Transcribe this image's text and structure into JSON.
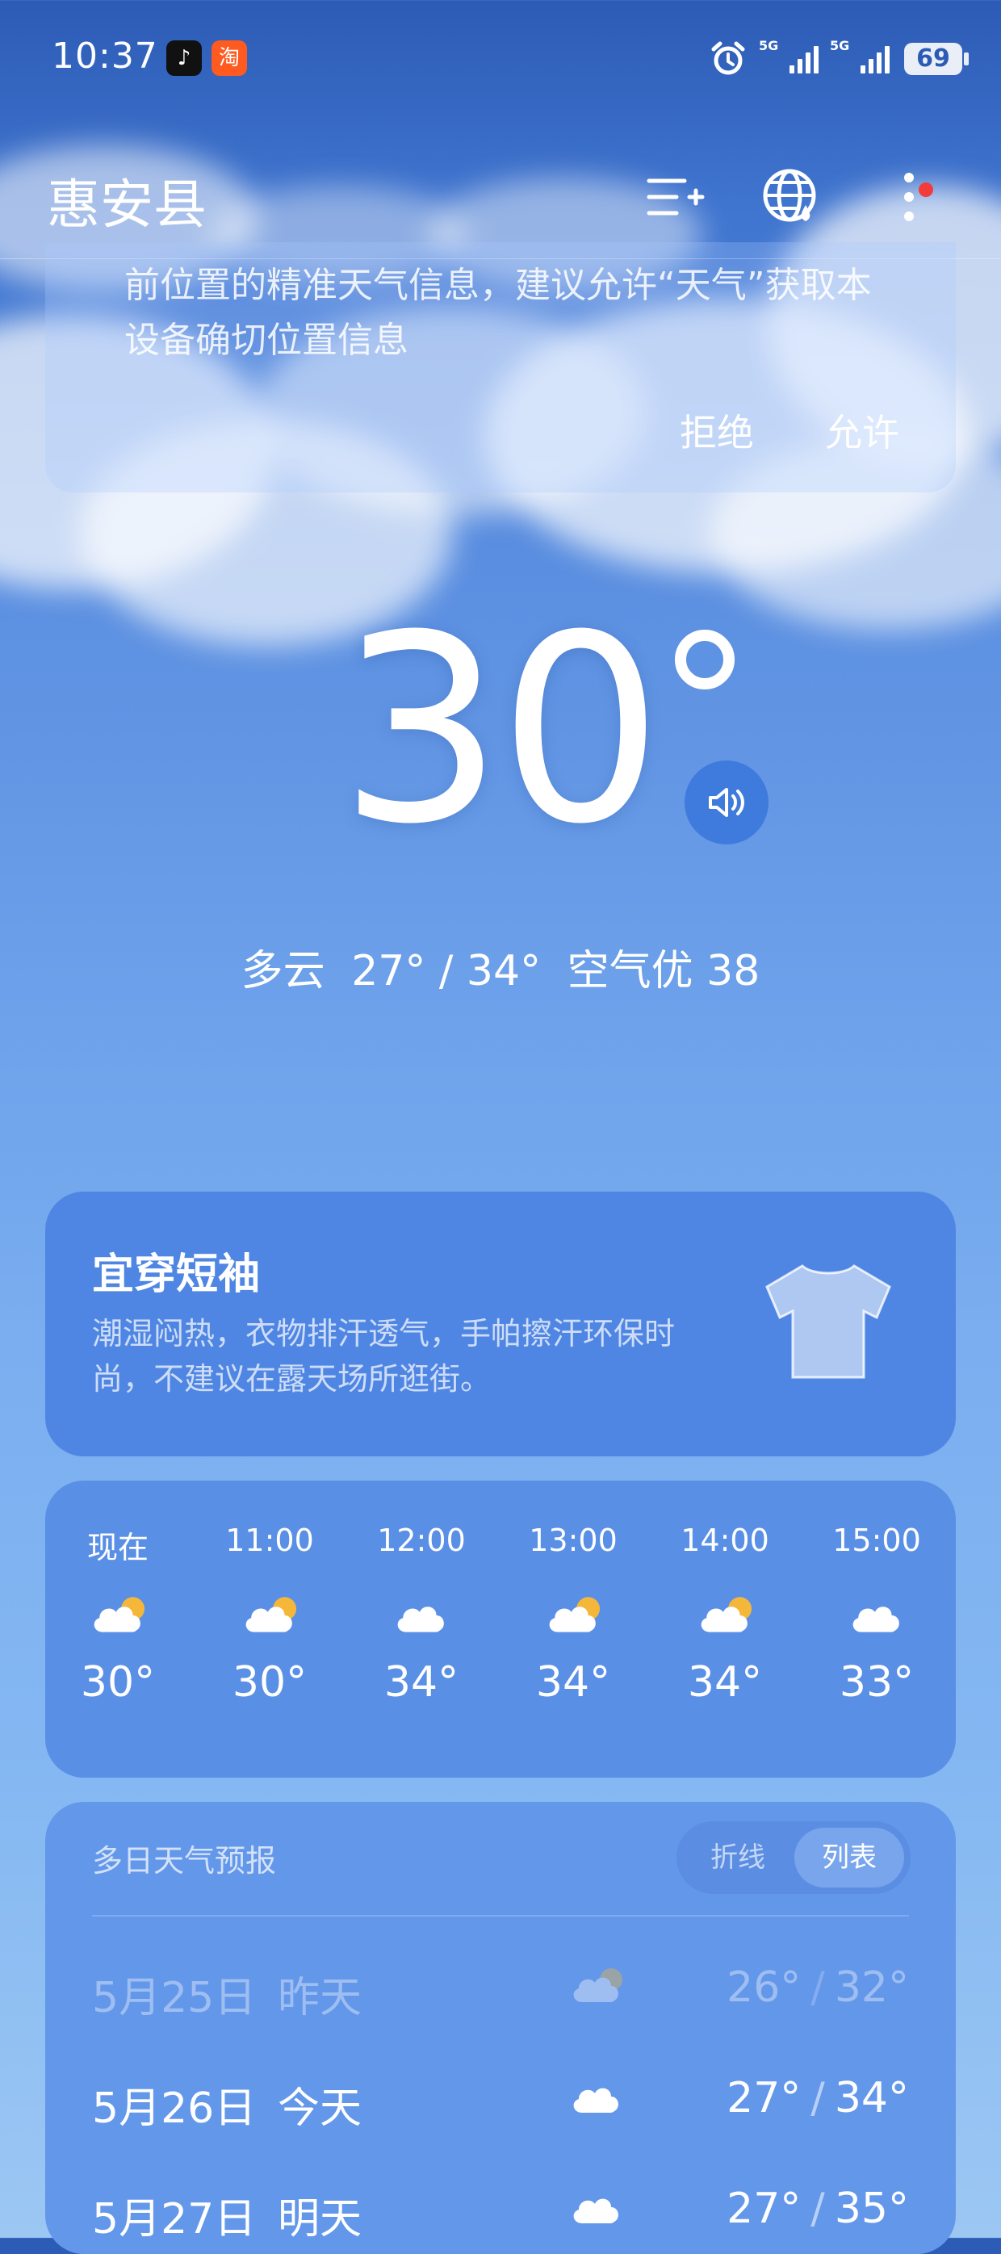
{
  "status_bar": {
    "time": "10:37",
    "signal_1": "5G",
    "signal_2": "5G",
    "battery": "69"
  },
  "header": {
    "city": "惠安县"
  },
  "permission": {
    "text": "前位置的精准天气信息，建议允许“天气”获取本设备确切位置信息",
    "deny": "拒绝",
    "allow": "允许"
  },
  "current": {
    "temperature": "30",
    "condition": "多云",
    "range": "27° / 34°",
    "air_quality": "空气优 38"
  },
  "clothing": {
    "title": "宜穿短袖",
    "description": "潮湿闷热，衣物排汗透气，手帕擦汗环保时尚，不建议在露天场所逛街。"
  },
  "hourly": [
    {
      "time": "现在",
      "icon": "partly-cloudy-icon",
      "temp": "30°"
    },
    {
      "time": "11:00",
      "icon": "partly-cloudy-icon",
      "temp": "30°"
    },
    {
      "time": "12:00",
      "icon": "cloud-icon",
      "temp": "34°"
    },
    {
      "time": "13:00",
      "icon": "partly-cloudy-icon",
      "temp": "34°"
    },
    {
      "time": "14:00",
      "icon": "partly-cloudy-icon",
      "temp": "34°"
    },
    {
      "time": "15:00",
      "icon": "cloud-icon",
      "temp": "33°"
    }
  ],
  "daily": {
    "title": "多日天气预报",
    "toggle": {
      "line": "折线",
      "list": "列表",
      "selected": "列表"
    },
    "days": [
      {
        "date": "5月25日",
        "name": "昨天",
        "icon": "partly-cloudy-icon",
        "low": "26°",
        "high": "32°"
      },
      {
        "date": "5月26日",
        "name": "今天",
        "icon": "cloud-icon",
        "low": "27°",
        "high": "34°"
      },
      {
        "date": "5月27日",
        "name": "明天",
        "icon": "cloud-icon",
        "low": "27°",
        "high": "35°"
      }
    ]
  },
  "colors": {
    "background_top": "#2c5bb5",
    "card": "#5a8fe6",
    "sun": "#f5b73a",
    "badge": "#f23c3c"
  }
}
